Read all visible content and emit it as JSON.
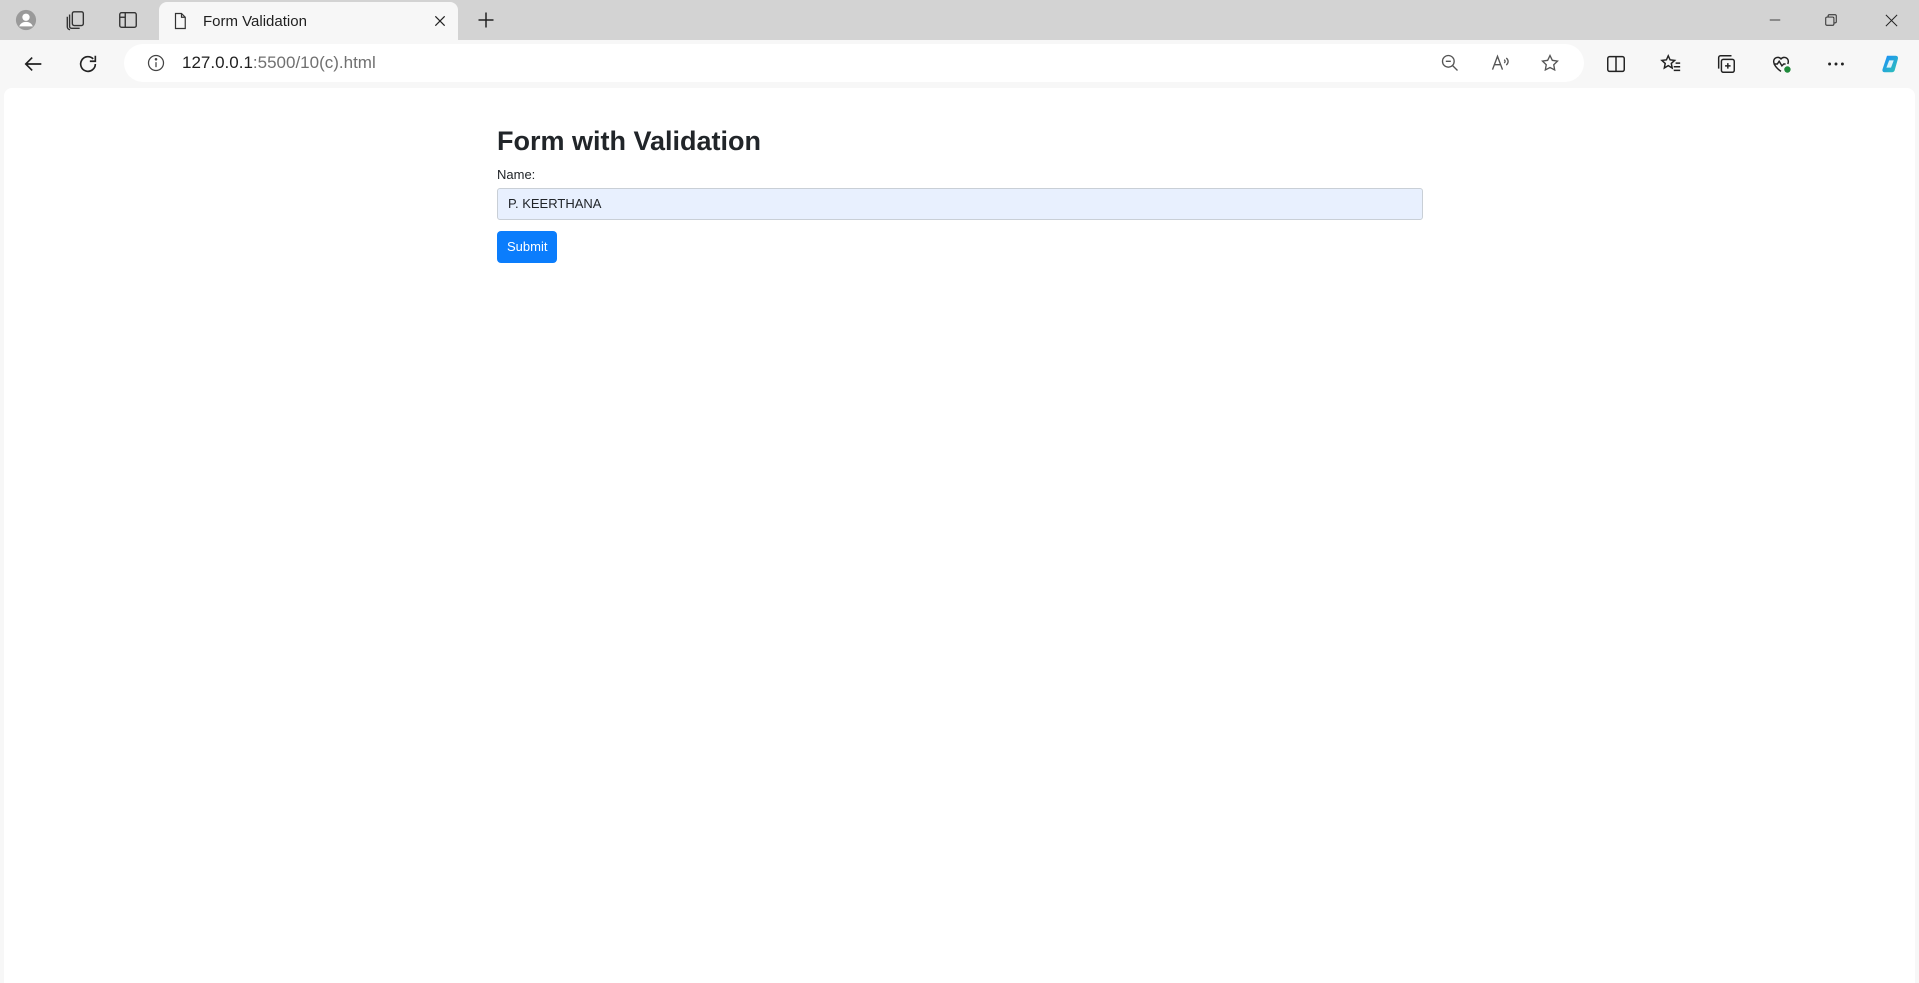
{
  "browser": {
    "tab": {
      "title": "Form Validation"
    },
    "address": {
      "host": "127.0.0.1",
      "rest": ":5500/10(c).html"
    }
  },
  "page": {
    "heading": "Form with Validation",
    "name_label": "Name:",
    "name_value": "P. KEERTHANA",
    "submit_label": "Submit"
  },
  "colors": {
    "button": "#0b7dfc",
    "input_autofill": "#e8f0fe"
  }
}
